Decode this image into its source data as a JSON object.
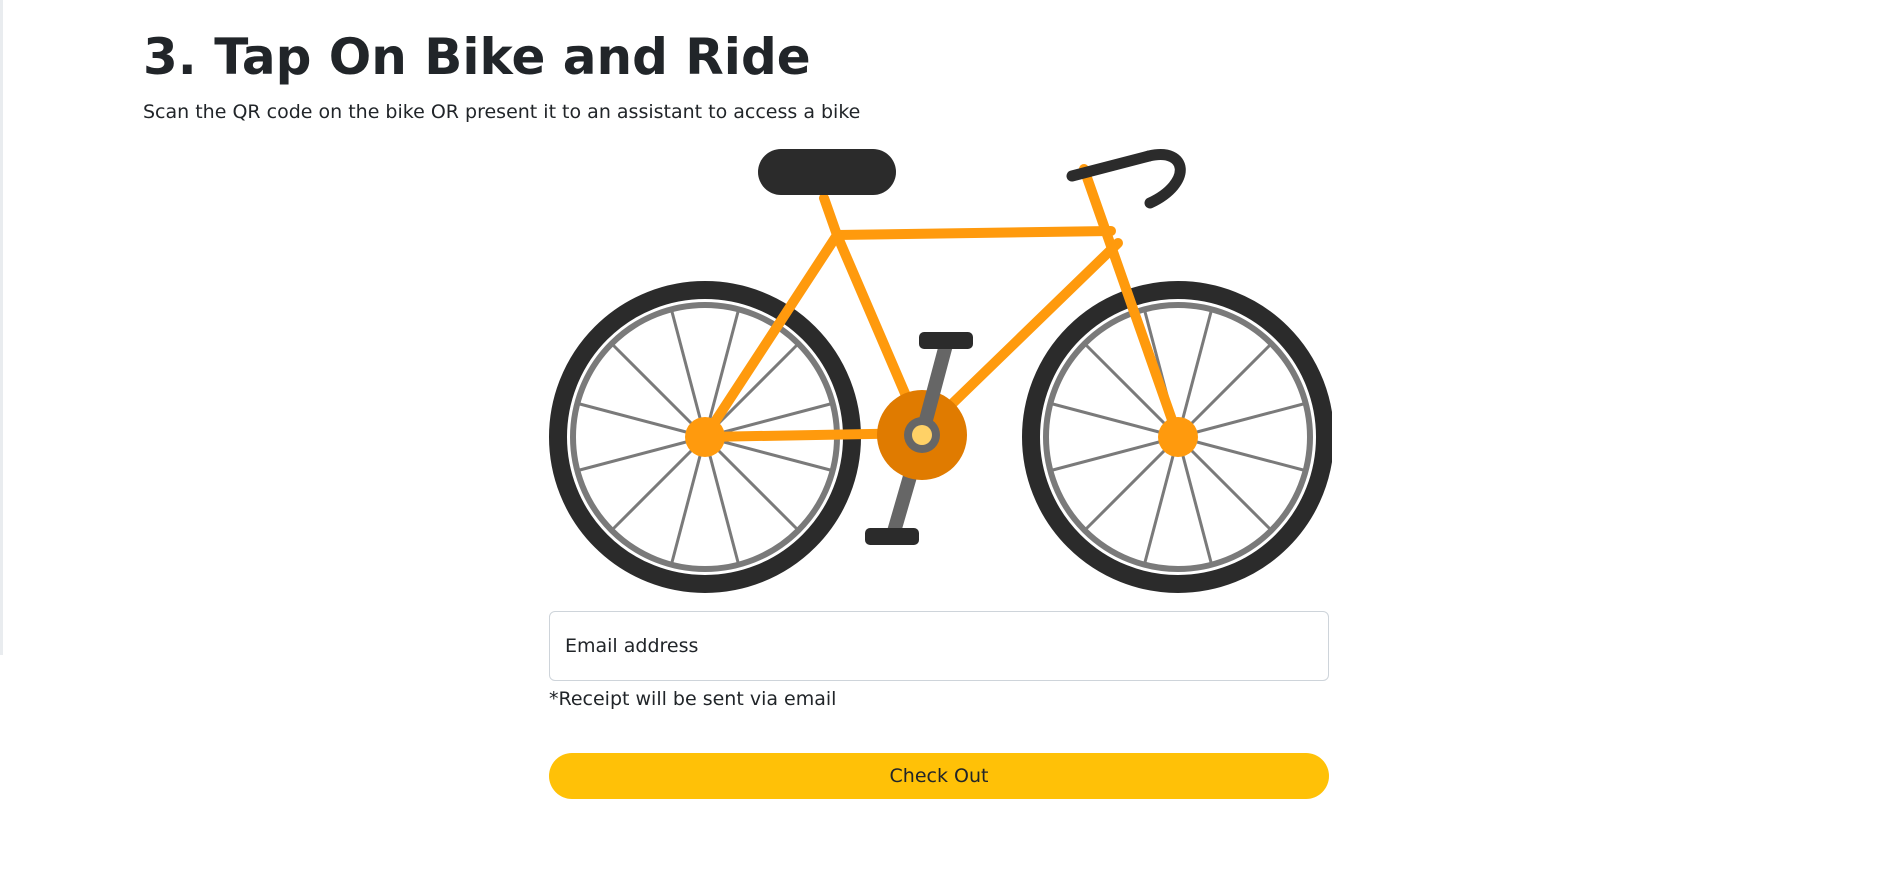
{
  "step": {
    "title": "3. Tap On Bike and Ride",
    "subtitle": "Scan the QR code on the bike OR present it to an assistant to access a bike"
  },
  "illustration": {
    "icon": "bicycle-illustration",
    "colors": {
      "frame": "#ff9a0d",
      "crank": "#e07b00",
      "tire": "#2b2b2b",
      "rim": "#7a7a7a",
      "hub_center": "#ffd166"
    }
  },
  "form": {
    "email_placeholder": "Email address",
    "email_value": "",
    "hint": "*Receipt will be sent via email",
    "submit_label": "Check Out"
  },
  "theme": {
    "accent": "#ffc107",
    "text": "#212529",
    "border": "#ced4da"
  }
}
